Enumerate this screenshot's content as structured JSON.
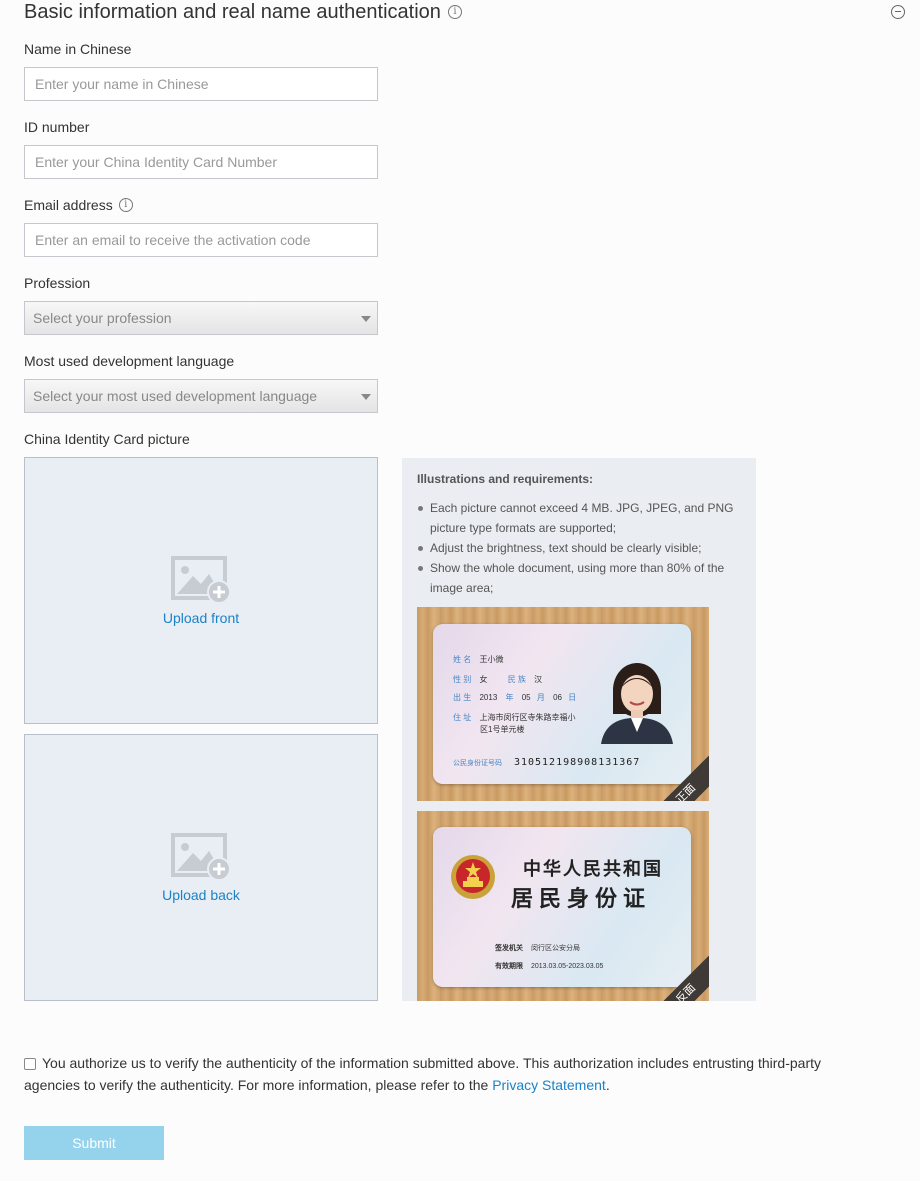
{
  "header": {
    "title": "Basic information and real name authentication",
    "info_glyph": "i"
  },
  "form": {
    "name": {
      "label": "Name in Chinese",
      "placeholder": "Enter your name in Chinese",
      "value": ""
    },
    "id_number": {
      "label": "ID number",
      "placeholder": "Enter your China Identity Card Number",
      "value": ""
    },
    "email": {
      "label": "Email address",
      "placeholder": "Enter an email to receive the activation code",
      "value": "",
      "info_glyph": "i"
    },
    "profession": {
      "label": "Profession",
      "selected": "Select your profession"
    },
    "language": {
      "label": "Most used development language",
      "selected": "Select your most used development language"
    },
    "id_picture": {
      "label": "China Identity Card picture"
    }
  },
  "upload": {
    "front_label": "Upload front",
    "back_label": "Upload back"
  },
  "illustrations": {
    "title": "Illustrations and requirements:",
    "items": [
      "Each picture cannot exceed 4 MB. JPG, JPEG, and PNG picture type formats are supported;",
      "Adjust the brightness, text should be clearly visible;",
      "Show the whole document, using more than 80% of the image area;"
    ],
    "front_card": {
      "name_key": "姓 名",
      "name_val": "王小微",
      "sex_key": "性 别",
      "sex_val": "女",
      "ethnic_key": "民 族",
      "ethnic_val": "汉",
      "birth_key": "出 生",
      "birth_year": "2013",
      "year_key": "年",
      "birth_month": "05",
      "month_key": "月",
      "birth_day": "06",
      "day_key": "日",
      "addr_key": "住 址",
      "addr_line1": "上海市闵行区寺朱路幸福小",
      "addr_line2": "区1号单元楼",
      "id_key": "公民身份证号码",
      "id_val": "310512198908131367",
      "ribbon": "正面"
    },
    "back_card": {
      "title1": "中华人民共和国",
      "title2": "居民身份证",
      "authority_key": "签发机关",
      "authority_val": "闵行区公安分局",
      "valid_key": "有效期限",
      "valid_val": "2013.03.05-2023.03.05",
      "ribbon": "反面"
    }
  },
  "auth": {
    "text": "You authorize us to verify the authenticity of the information submitted above. This authorization includes entrusting third-party agencies to verify the authenticity. For more information, please refer to the",
    "link": "Privacy Statement",
    "end": "."
  },
  "submit_label": "Submit",
  "colors": {
    "link": "#1b82c7",
    "submit_bg": "#95d3ec",
    "upload_bg": "#e9edf4"
  }
}
